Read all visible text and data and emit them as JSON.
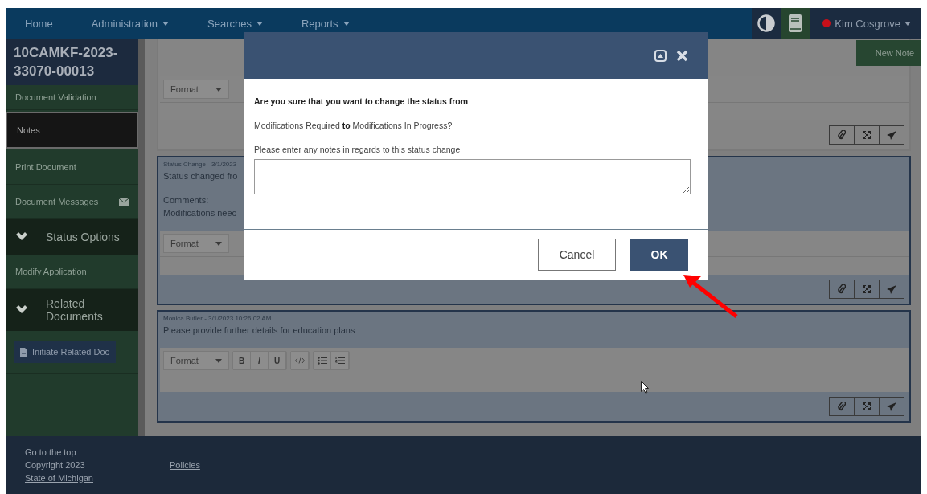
{
  "nav": {
    "items": [
      {
        "label": "Home",
        "dropdown": false
      },
      {
        "label": "Administration",
        "dropdown": true
      },
      {
        "label": "Searches",
        "dropdown": true
      },
      {
        "label": "Reports",
        "dropdown": true
      }
    ],
    "user": {
      "name": "Kim Cosgrove",
      "color": "#c8101a",
      "dropdown": true
    }
  },
  "sidebar": {
    "title": "10CAMKF-2023-33070-00013",
    "items": [
      {
        "kind": "link",
        "label": "Document Validation",
        "selected": false
      },
      {
        "kind": "link",
        "label": "Notes",
        "selected": true
      },
      {
        "kind": "link",
        "label": "Print Document",
        "selected": false
      },
      {
        "kind": "messages",
        "label": "Document Messages",
        "selected": false
      },
      {
        "kind": "section",
        "label": "Status Options",
        "expanded": true
      },
      {
        "kind": "link",
        "label": "Modify Application",
        "selected": false
      },
      {
        "kind": "section",
        "label": "Related Documents",
        "expanded": true
      },
      {
        "kind": "action",
        "label": "Initiate Related Doc"
      }
    ]
  },
  "new_note_button": "New Note",
  "notes": [
    {
      "kind": "draft",
      "toolbar": {
        "format": "Format"
      }
    },
    {
      "kind": "entry",
      "header": "Status Change - 3/1/2023",
      "paragraphs": [
        [
          "Status changed fro"
        ],
        [
          "Comments:",
          "Modifications neec"
        ]
      ],
      "toolbar": {
        "format": "Format"
      }
    },
    {
      "kind": "entry",
      "header": "Monica Butler - 3/1/2023 10:26:02 AM",
      "paragraphs": [
        [
          "Please provide further details for education plans"
        ]
      ],
      "toolbar": {
        "format": "Format",
        "buttons": [
          "B",
          "I",
          "U"
        ]
      }
    }
  ],
  "footer": {
    "top_link": "Go to the top",
    "copyright": "Copyright 2023",
    "copyright_link": "State of Michigan",
    "policies_link": "Policies"
  },
  "dialog": {
    "question": "Are you sure that you want to change the status from",
    "change": "Modifications Required **to** Modifications In Progress?",
    "notes_label": "Please enter any notes in regards to this status change",
    "buttons": [
      {
        "label": "Cancel",
        "primary": false
      },
      {
        "label": "OK",
        "primary": true
      }
    ]
  }
}
